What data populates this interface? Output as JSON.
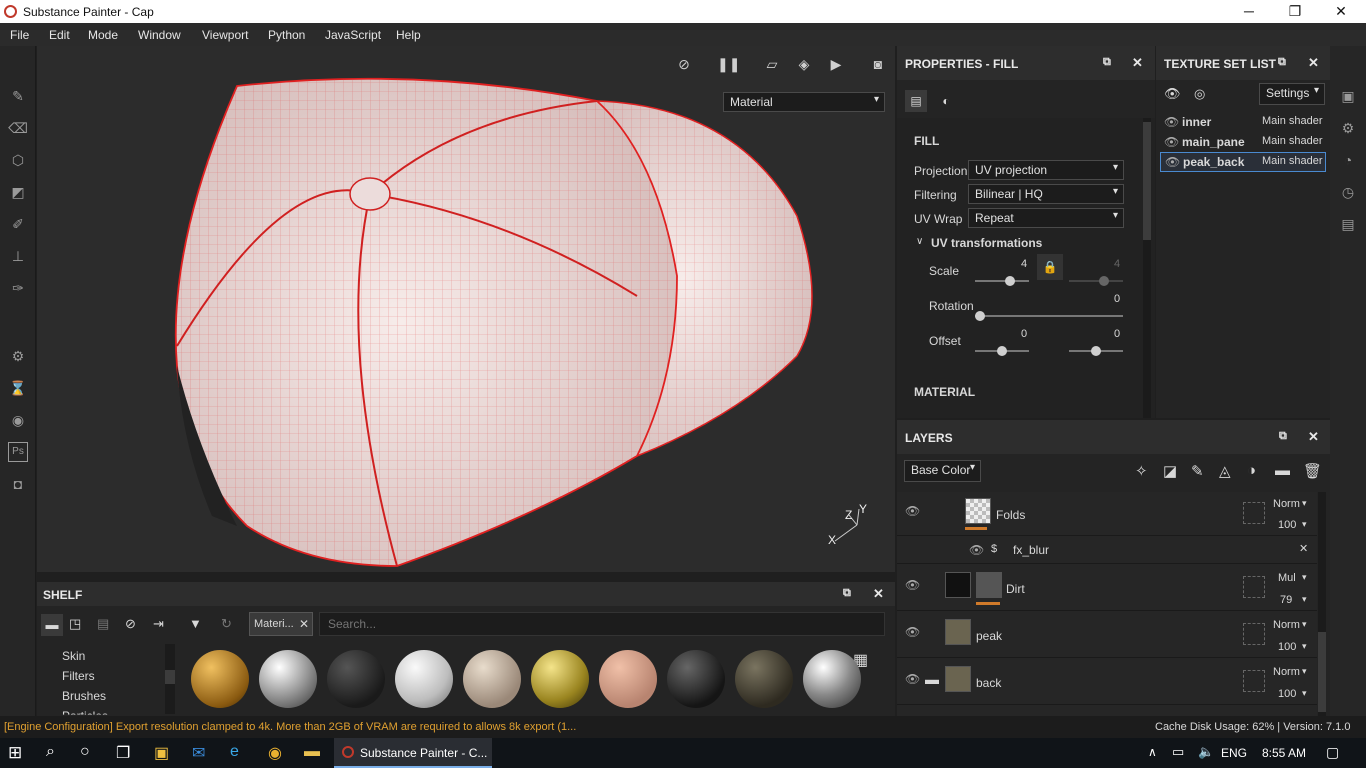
{
  "window": {
    "title": "Substance Painter - Cap",
    "minimize": "─",
    "restore": "❐",
    "close": "✕"
  },
  "menu": [
    "File",
    "Edit",
    "Mode",
    "Window",
    "Viewport",
    "Python",
    "JavaScript",
    "Help"
  ],
  "viewport": {
    "material_mode": "Material",
    "axis_labels": {
      "x": "X",
      "y": "Y",
      "z": "Z"
    }
  },
  "properties": {
    "title": "PROPERTIES - FILL",
    "section": "FILL",
    "projection_label": "Projection",
    "projection_value": "UV projection",
    "filtering_label": "Filtering",
    "filtering_value": "Bilinear | HQ",
    "uvwrap_label": "UV Wrap",
    "uvwrap_value": "Repeat",
    "uvt_label": "UV transformations",
    "scale_label": "Scale",
    "scale_value": "4",
    "scale_value2": "4",
    "rotation_label": "Rotation",
    "rotation_value": "0",
    "offset_label": "Offset",
    "offset_value1": "0",
    "offset_value2": "0",
    "material_section": "MATERIAL"
  },
  "texture_set_list": {
    "title": "TEXTURE SET LIST",
    "settings": "Settings",
    "items": [
      {
        "name": "inner",
        "shader": "Main shader"
      },
      {
        "name": "main_pane",
        "shader": "Main shader"
      },
      {
        "name": "peak_back",
        "shader": "Main shader"
      }
    ]
  },
  "layers": {
    "title": "LAYERS",
    "channel": "Base Color",
    "rows": [
      {
        "name": "Folds",
        "blend": "Norm",
        "opacity": "100"
      },
      {
        "name": "fx_blur"
      },
      {
        "name": "Dirt",
        "blend": "Mul",
        "opacity": "79"
      },
      {
        "name": "peak",
        "blend": "Norm",
        "opacity": "100"
      },
      {
        "name": "back",
        "blend": "Norm",
        "opacity": "100"
      }
    ]
  },
  "shelf": {
    "title": "SHELF",
    "filter_tag": "Materi...",
    "search_placeholder": "Search...",
    "categories": [
      "Skin",
      "Filters",
      "Brushes",
      "Particles"
    ]
  },
  "status": {
    "message": "[Engine Configuration] Export resolution clamped to 4k. More than 2GB of VRAM are required to allows 8k export (1...",
    "cache": "Cache Disk Usage:  62% | Version: 7.1.0"
  },
  "taskbar": {
    "app_label": "Substance Painter - C...",
    "lang": "ENG",
    "time": "8:55 AM"
  },
  "colors": {
    "accent": "#d07a2a",
    "status_text": "#e0a030",
    "wire": "#e03030"
  }
}
